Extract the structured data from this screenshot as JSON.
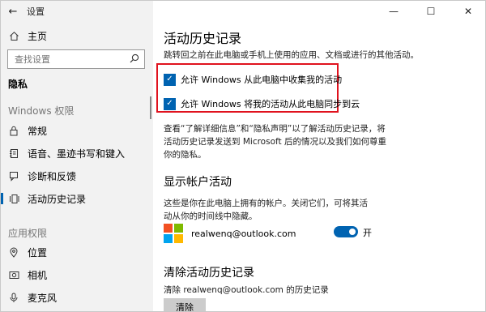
{
  "window": {
    "title": "设置",
    "back_glyph": "←",
    "minimize_glyph": "—",
    "maximize_glyph": "☐",
    "close_glyph": "✕"
  },
  "sidebar": {
    "home": {
      "label": "主页",
      "icon": "home-icon"
    },
    "search": {
      "placeholder": "查找设置",
      "icon": "search-icon"
    },
    "category": "隐私",
    "section_windows": "Windows 权限",
    "windows_items": [
      {
        "label": "常规",
        "icon": "lock-icon"
      },
      {
        "label": "语音、墨迹书写和键入",
        "icon": "notebook-icon"
      },
      {
        "label": "诊断和反馈",
        "icon": "feedback-icon"
      },
      {
        "label": "活动历史记录",
        "icon": "activity-icon",
        "active": true
      }
    ],
    "section_apps": "应用权限",
    "app_items": [
      {
        "label": "位置",
        "icon": "location-icon"
      },
      {
        "label": "相机",
        "icon": "camera-icon"
      },
      {
        "label": "麦克风",
        "icon": "microphone-icon"
      }
    ]
  },
  "main": {
    "title": "活动历史记录",
    "description": "跳转回之前在此电脑或手机上使用的应用、文档或进行的其他活动。",
    "checkboxes": [
      {
        "label": "允许 Windows 从此电脑中收集我的活动",
        "checked": true
      },
      {
        "label": "允许 Windows 将我的活动从此电脑同步到云",
        "checked": true
      }
    ],
    "info_text": "查看“了解详细信息”和“隐私声明”以了解活动历史记录，将活动历史记录发送到 Microsoft 后的情况以及我们如何尊重你的隐私。",
    "accounts_heading": "显示帐户活动",
    "accounts_desc": "这些是你在此电脑上拥有的帐户。关闭它们，可将其活动从你的时间线中隐藏。",
    "account_email": "realwenq@outlook.com",
    "toggle_state": "开",
    "clear_heading": "清除活动历史记录",
    "clear_desc": "清除 realwenq@outlook.com 的历史记录",
    "clear_button": "清除"
  },
  "colors": {
    "accent": "#0063b1",
    "highlight_box": "#e0121e",
    "ms_logo": [
      "#f25022",
      "#7fba00",
      "#00a4ef",
      "#ffb900"
    ]
  }
}
